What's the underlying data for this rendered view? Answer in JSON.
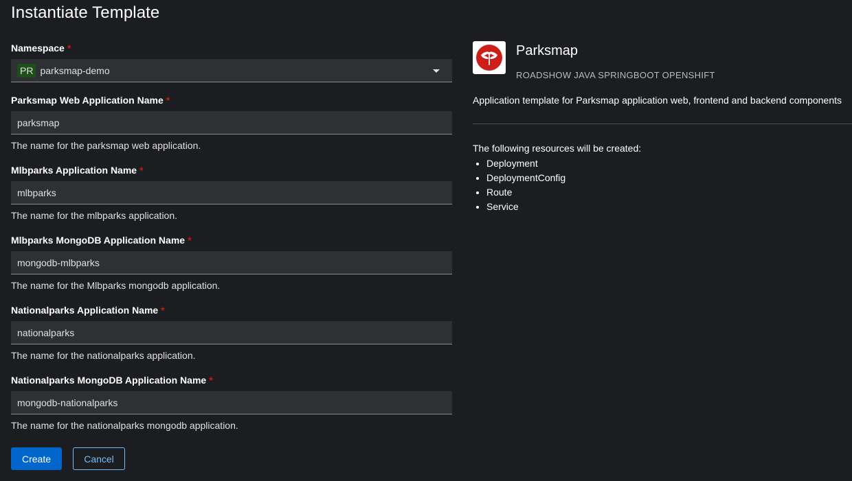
{
  "page": {
    "title": "Instantiate Template"
  },
  "form": {
    "namespace": {
      "label": "Namespace",
      "required": "*",
      "badge": "PR",
      "value": "parksmap-demo"
    },
    "fields": [
      {
        "label": "Parksmap Web Application Name",
        "required": "*",
        "value": "parksmap",
        "helper": "The name for the parksmap web application."
      },
      {
        "label": "Mlbparks Application Name",
        "required": "*",
        "value": "mlbparks",
        "helper": "The name for the mlbparks application."
      },
      {
        "label": "Mlbparks MongoDB Application Name",
        "required": "*",
        "value": "mongodb-mlbparks",
        "helper": "The name for the Mlbparks mongodb application."
      },
      {
        "label": "Nationalparks Application Name",
        "required": "*",
        "value": "nationalparks",
        "helper": "The name for the nationalparks application."
      },
      {
        "label": "Nationalparks MongoDB Application Name",
        "required": "*",
        "value": "mongodb-nationalparks",
        "helper": "The name for the nationalparks mongodb application."
      }
    ],
    "buttons": {
      "create": "Create",
      "cancel": "Cancel"
    }
  },
  "template": {
    "logo_icon": "dragonfly-icon",
    "title": "Parksmap",
    "tags": "ROADSHOW JAVA SPRINGBOOT OPENSHIFT",
    "description": "Application template for Parksmap application web, frontend and backend components",
    "resources_intro": "The following resources will be created:",
    "resources": [
      "Deployment",
      "DeploymentConfig",
      "Route",
      "Service"
    ]
  },
  "colors": {
    "background": "#1b1d21",
    "input_bg": "#2e3034",
    "primary": "#0066cc",
    "link": "#73bcf7",
    "required": "#c9190b",
    "logo_red": "#cc1f1a"
  }
}
